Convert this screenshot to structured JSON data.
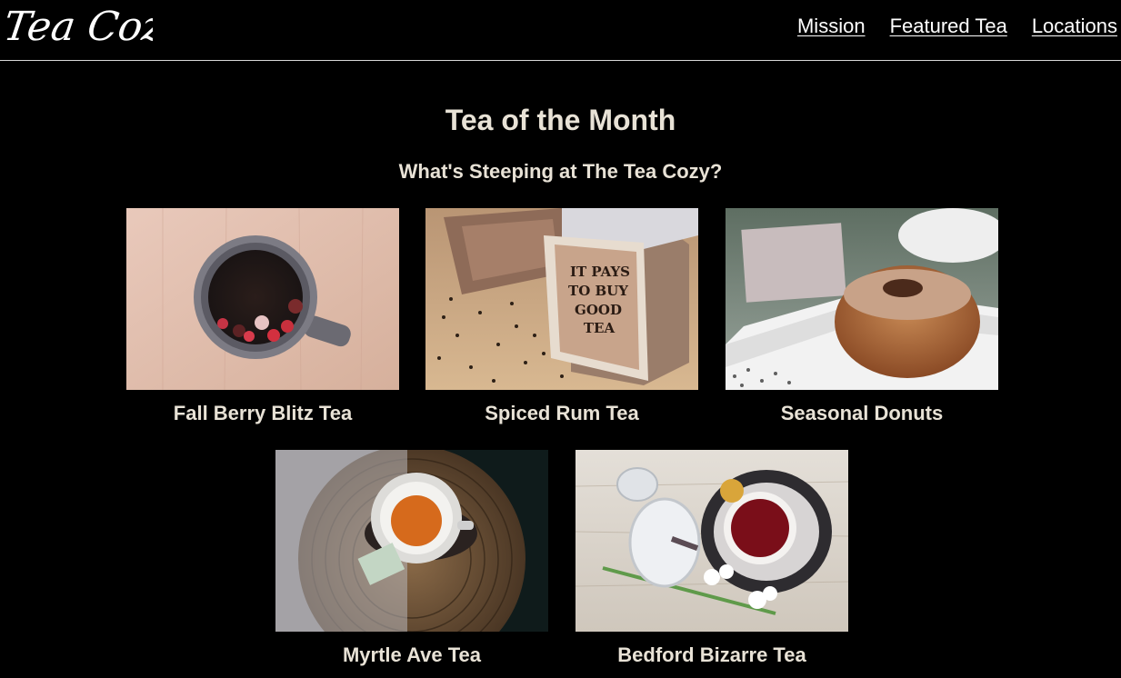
{
  "header": {
    "logo_text": "Tea Cozy",
    "nav": [
      {
        "label": "Mission"
      },
      {
        "label": "Featured Tea"
      },
      {
        "label": "Locations"
      }
    ]
  },
  "main": {
    "title": "Tea of the Month",
    "subtitle": "What's Steeping at The Tea Cozy?",
    "teas": [
      {
        "name": "Fall Berry Blitz Tea"
      },
      {
        "name": "Spiced Rum Tea",
        "crate_text": [
          "IT PAYS",
          "TO BUY",
          "GOOD",
          "TEA"
        ]
      },
      {
        "name": "Seasonal Donuts"
      },
      {
        "name": "Myrtle Ave Tea"
      },
      {
        "name": "Bedford Bizarre Tea"
      }
    ]
  },
  "colors": {
    "background": "#000000",
    "text": "#e8e2d6",
    "nav_link": "#ffffff",
    "header_rule": "#d8d8d8"
  }
}
